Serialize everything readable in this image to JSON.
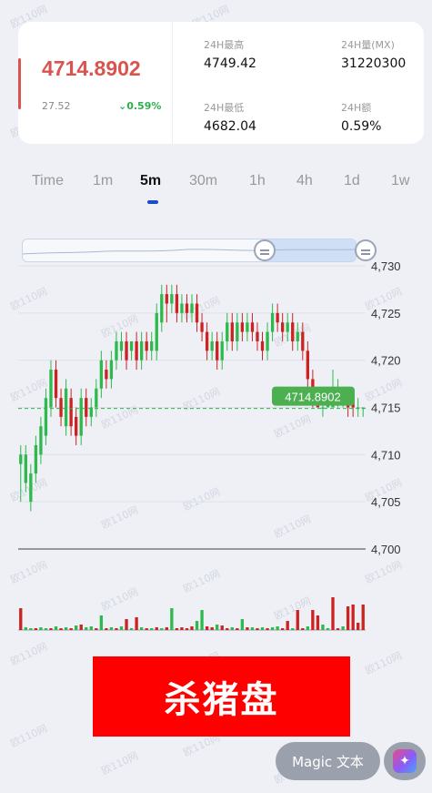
{
  "ticker": {
    "price": "4714.8902",
    "change_abs": "27.52",
    "change_pct": "0.59%",
    "stats": [
      {
        "label": "24H最高",
        "value": "4749.42"
      },
      {
        "label": "24H量(MX)",
        "value": "31220300"
      },
      {
        "label": "24H最低",
        "value": "4682.04"
      },
      {
        "label": "24H额",
        "value": "0.59%"
      }
    ]
  },
  "tabs": [
    "Time",
    "1m",
    "5m",
    "30m",
    "1h",
    "4h",
    "1d",
    "1w"
  ],
  "active_tab": "5m",
  "chart_data": {
    "type": "candlestick",
    "y_ticks": [
      "4,730",
      "4,725",
      "4,720",
      "4,715",
      "4,710",
      "4,705",
      "4,700"
    ],
    "ylim": [
      4700,
      4732
    ],
    "current_price_label": "4714.8902",
    "current_price": 4714.89,
    "candles": [
      [
        4709,
        4710,
        4705,
        4711
      ],
      [
        4707,
        4710,
        4706,
        4711
      ],
      [
        4705,
        4708,
        4704,
        4709
      ],
      [
        4708,
        4711,
        4707,
        4712
      ],
      [
        4710,
        4713,
        4709,
        4714
      ],
      [
        4712,
        4716,
        4711,
        4717
      ],
      [
        4715,
        4719,
        4714,
        4720
      ],
      [
        4719,
        4716,
        4715,
        4720
      ],
      [
        4716,
        4714,
        4713,
        4717
      ],
      [
        4713,
        4717,
        4712,
        4718
      ],
      [
        4716,
        4713,
        4712,
        4717
      ],
      [
        4714,
        4712,
        4711,
        4715
      ],
      [
        4712,
        4716,
        4711,
        4717
      ],
      [
        4716,
        4714,
        4713,
        4717
      ],
      [
        4714,
        4715,
        4713,
        4716
      ],
      [
        4715,
        4717,
        4714,
        4718
      ],
      [
        4717,
        4720,
        4716,
        4721
      ],
      [
        4719,
        4718,
        4717,
        4720
      ],
      [
        4718,
        4720,
        4717,
        4721
      ],
      [
        4720,
        4722,
        4719,
        4723
      ],
      [
        4721,
        4722,
        4720,
        4723
      ],
      [
        4722,
        4720,
        4719,
        4723
      ],
      [
        4721,
        4722,
        4720,
        4722
      ],
      [
        4722,
        4720,
        4719,
        4723
      ],
      [
        4720,
        4722,
        4719,
        4723
      ],
      [
        4722,
        4721,
        4720,
        4723
      ],
      [
        4721,
        4722,
        4720,
        4723
      ],
      [
        4721,
        4725,
        4720,
        4726
      ],
      [
        4724,
        4727,
        4723,
        4728
      ],
      [
        4727,
        4726,
        4724,
        4728
      ],
      [
        4726,
        4727,
        4725,
        4728
      ],
      [
        4727,
        4725,
        4724,
        4728
      ],
      [
        4725,
        4726,
        4724,
        4727
      ],
      [
        4726,
        4725,
        4724,
        4727
      ],
      [
        4725,
        4726,
        4724,
        4727
      ],
      [
        4726,
        4724,
        4723,
        4727
      ],
      [
        4724,
        4723,
        4722,
        4725
      ],
      [
        4723,
        4721,
        4720,
        4724
      ],
      [
        4721,
        4722,
        4720,
        4723
      ],
      [
        4722,
        4720,
        4719,
        4723
      ],
      [
        4720,
        4722,
        4719,
        4723
      ],
      [
        4722,
        4724,
        4721,
        4725
      ],
      [
        4724,
        4722,
        4721,
        4725
      ],
      [
        4722,
        4724,
        4721,
        4725
      ],
      [
        4724,
        4723,
        4722,
        4725
      ],
      [
        4723,
        4724,
        4722,
        4725
      ],
      [
        4724,
        4723,
        4722,
        4725
      ],
      [
        4723,
        4722,
        4721,
        4724
      ],
      [
        4722,
        4721,
        4720,
        4723
      ],
      [
        4721,
        4723,
        4720,
        4724
      ],
      [
        4723,
        4725,
        4722,
        4726
      ],
      [
        4725,
        4724,
        4723,
        4726
      ],
      [
        4724,
        4723,
        4722,
        4725
      ],
      [
        4723,
        4724,
        4722,
        4725
      ],
      [
        4724,
        4722,
        4721,
        4725
      ],
      [
        4722,
        4723,
        4721,
        4724
      ],
      [
        4723,
        4721,
        4720,
        4724
      ],
      [
        4721,
        4718,
        4717,
        4722
      ],
      [
        4718,
        4716,
        4715,
        4719
      ],
      [
        4716,
        4715,
        4715,
        4717
      ],
      [
        4715,
        4715,
        4714,
        4716
      ],
      [
        4715,
        4716,
        4715,
        4717
      ],
      [
        4715,
        4716,
        4715,
        4719
      ],
      [
        4716,
        4717,
        4715,
        4718
      ],
      [
        4716,
        4716,
        4715,
        4717
      ],
      [
        4716,
        4715,
        4714,
        4717
      ],
      [
        4716,
        4715,
        4714,
        4717
      ],
      [
        4715,
        4715,
        4714,
        4716
      ],
      [
        4715,
        4715,
        4714,
        4715
      ]
    ],
    "volumes": [
      24,
      3,
      2,
      2,
      3,
      2,
      2,
      4,
      2,
      3,
      2,
      5,
      6,
      3,
      4,
      2,
      16,
      2,
      3,
      2,
      4,
      12,
      2,
      14,
      3,
      2,
      2,
      3,
      2,
      3,
      24,
      2,
      3,
      2,
      4,
      10,
      22,
      4,
      3,
      6,
      5,
      2,
      3,
      2,
      12,
      3,
      3,
      2,
      3,
      2,
      3,
      4,
      2,
      10,
      2,
      22,
      2,
      4,
      22,
      16,
      6,
      2,
      36,
      2,
      4,
      26,
      28,
      8,
      28
    ],
    "volume_up": [
      false,
      true,
      true,
      false,
      true,
      true,
      false,
      true,
      false,
      true,
      false,
      true,
      false,
      true,
      true,
      false,
      true,
      false,
      true,
      false,
      true,
      false,
      true,
      false,
      true,
      false,
      true,
      false,
      true,
      false,
      true,
      false,
      false,
      false,
      false,
      true,
      true,
      false,
      false,
      true,
      false,
      false,
      true,
      false,
      true,
      false,
      true,
      false,
      true,
      false,
      true,
      true,
      false,
      false,
      true,
      false,
      false,
      true,
      false,
      false,
      true,
      true,
      false,
      false,
      true,
      false,
      false,
      false,
      false
    ]
  },
  "banner_text": "杀猪盘",
  "magic_label": "Magic 文本",
  "watermark": "欧110网",
  "colors": {
    "up": "#2db94d",
    "down": "#cc2222",
    "accent": "#1a4ec9",
    "price": "#d9534f",
    "label_bg": "#4caf50"
  }
}
